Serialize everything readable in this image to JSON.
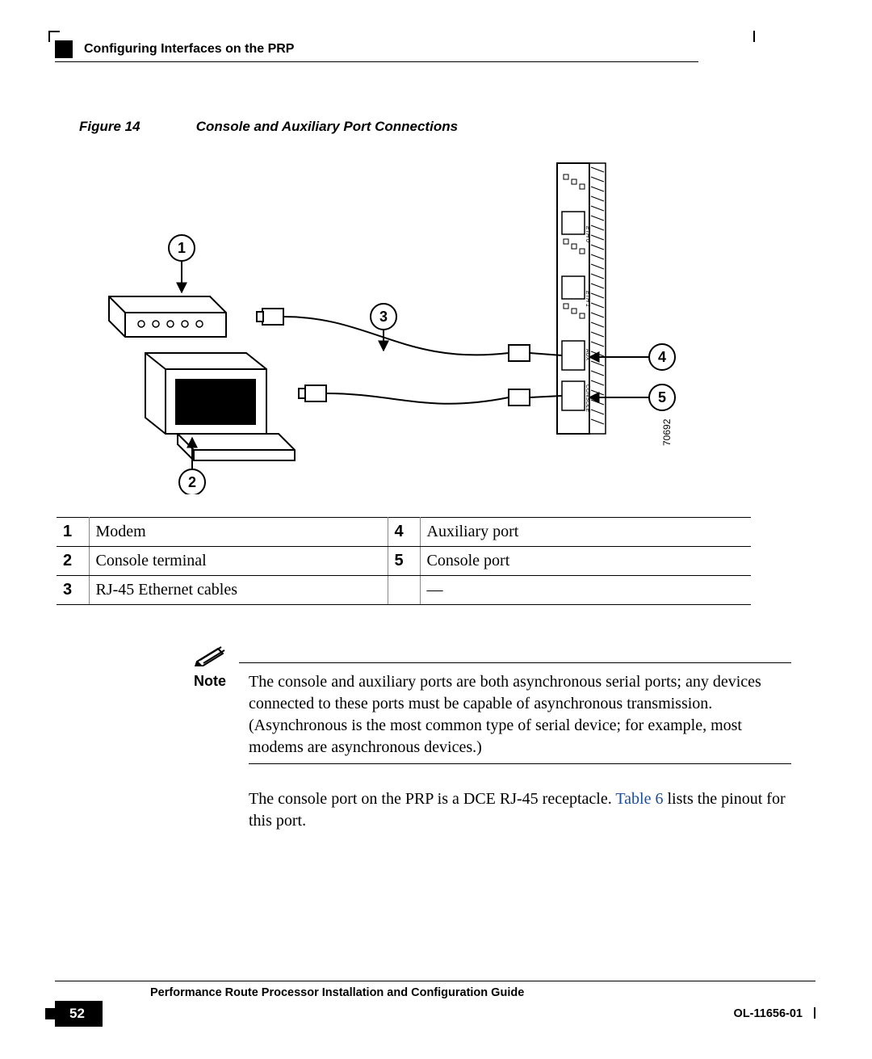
{
  "header": {
    "section_title": "Configuring Interfaces on the PRP"
  },
  "figure": {
    "label": "Figure 14",
    "caption": "Console and Auxiliary Port Connections",
    "callouts": {
      "c1": "1",
      "c2": "2",
      "c3": "3",
      "c4": "4",
      "c5": "5"
    },
    "side_label": "70692",
    "port_labels": {
      "eth0": "ETH 0",
      "eth1": "ETH 1",
      "aux": "AUX",
      "console": "CONSOLE"
    }
  },
  "legend": {
    "rows": [
      {
        "n": "1",
        "d": "Modem",
        "n2": "4",
        "d2": "Auxiliary port"
      },
      {
        "n": "2",
        "d": "Console terminal",
        "n2": "5",
        "d2": "Console port"
      },
      {
        "n": "3",
        "d": "RJ-45 Ethernet cables",
        "n2": "",
        "d2": "—"
      }
    ]
  },
  "note": {
    "label": "Note",
    "text": "The console and auxiliary ports are both asynchronous serial ports; any devices connected to these ports must be capable of asynchronous transmission. (Asynchronous is the most common type of serial device; for example, most modems are asynchronous devices.)"
  },
  "paragraph": {
    "pre": "The console port on the PRP is a DCE RJ-45 receptacle. ",
    "link": "Table 6",
    "post": " lists the pinout for this port."
  },
  "footer": {
    "doc_title": "Performance Route Processor Installation and Configuration Guide",
    "page": "52",
    "doc_id": "OL-11656-01"
  }
}
